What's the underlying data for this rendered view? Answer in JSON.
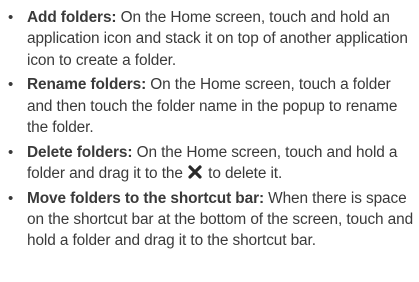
{
  "items": [
    {
      "term": "Add folders:",
      "text": " On the Home screen, touch and hold an application icon and stack it on top of another application icon to create a folder."
    },
    {
      "term": "Rename folders:",
      "text": " On the Home screen, touch a folder and then touch the folder name in the popup to rename the folder."
    },
    {
      "term": "Delete folders:",
      "text_before": " On the Home screen, touch and hold a folder and drag it to the ",
      "icon": "close-x-icon",
      "text_after": " to delete it."
    },
    {
      "term": "Move folders to the shortcut bar:",
      "text": " When there is space on the shortcut bar at the bottom of the screen, touch and hold a folder and drag it to the shortcut bar."
    }
  ],
  "bullet_char": "•"
}
